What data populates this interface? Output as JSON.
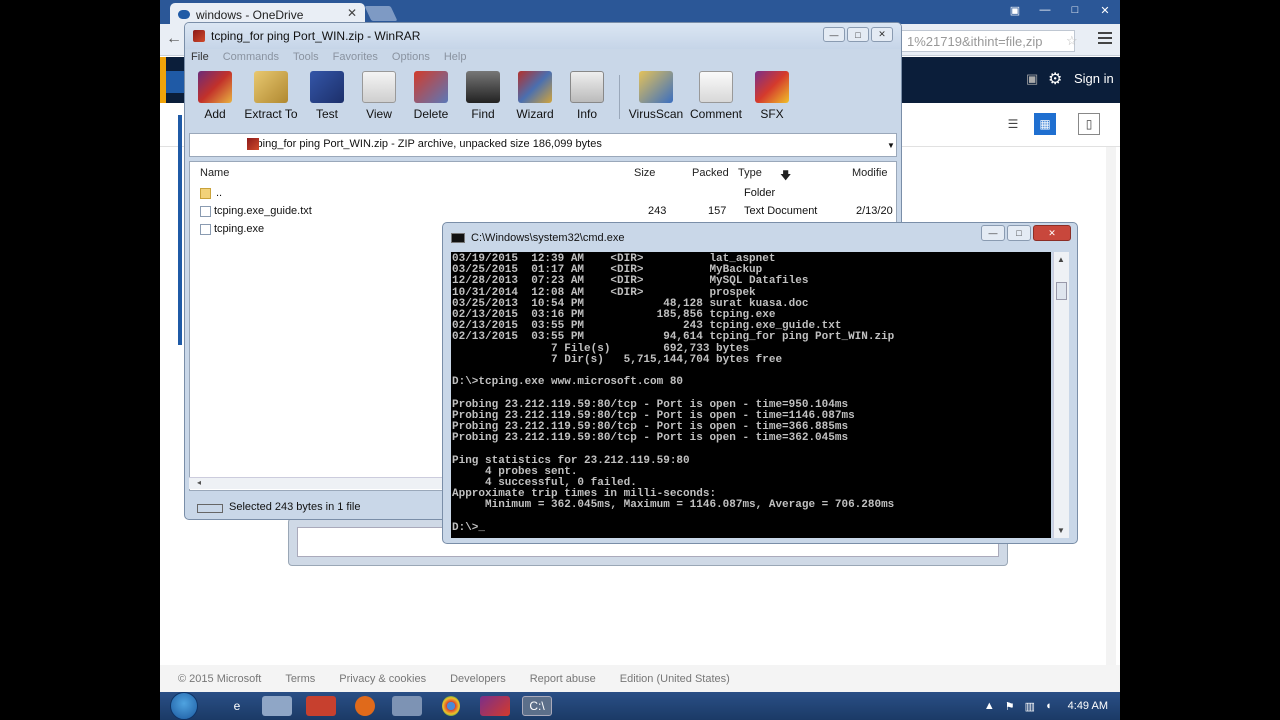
{
  "chrome": {
    "tab_title": "windows - OneDrive",
    "url_tail": "1%21719&ithint=file,zip",
    "tab_close": "✕"
  },
  "onedrive": {
    "sign_in": "Sign in",
    "footer": {
      "copyright": "© 2015 Microsoft",
      "terms": "Terms",
      "privacy": "Privacy & cookies",
      "developers": "Developers",
      "report": "Report abuse",
      "edition": "Edition (United States)"
    }
  },
  "winrar": {
    "title": "tcping_for ping Port_WIN.zip - WinRAR",
    "menu": [
      "File",
      "Commands",
      "Tools",
      "Favorites",
      "Options",
      "Help"
    ],
    "toolbar": [
      "Add",
      "Extract To",
      "Test",
      "View",
      "Delete",
      "Find",
      "Wizard",
      "Info",
      "VirusScan",
      "Comment",
      "SFX"
    ],
    "address": "tcping_for ping Port_WIN.zip - ZIP archive, unpacked size 186,099 bytes",
    "columns": {
      "name": "Name",
      "size": "Size",
      "packed": "Packed",
      "type": "Type",
      "modified": "Modifie"
    },
    "rows": [
      {
        "name": "..",
        "size": "",
        "packed": "",
        "type": "Folder",
        "modified": ""
      },
      {
        "name": "tcping.exe_guide.txt",
        "size": "243",
        "packed": "157",
        "type": "Text Document",
        "modified": "2/13/20"
      },
      {
        "name": "tcping.exe",
        "size": "",
        "packed": "",
        "type": "",
        "modified": ""
      }
    ],
    "status": "Selected 243 bytes in 1 file"
  },
  "cmd": {
    "title": "C:\\Windows\\system32\\cmd.exe",
    "text": "03/19/2015  12:39 AM    <DIR>          lat_aspnet\n03/25/2015  01:17 AM    <DIR>          MyBackup\n12/28/2013  07:23 AM    <DIR>          MySQL Datafiles\n10/31/2014  12:08 AM    <DIR>          prospek\n03/25/2013  10:54 PM            48,128 surat kuasa.doc\n02/13/2015  03:16 PM           185,856 tcping.exe\n02/13/2015  03:55 PM               243 tcping.exe_guide.txt\n02/13/2015  03:55 PM            94,614 tcping_for ping Port_WIN.zip\n               7 File(s)        692,733 bytes\n               7 Dir(s)   5,715,144,704 bytes free\n\nD:\\>tcping.exe www.microsoft.com 80\n\nProbing 23.212.119.59:80/tcp - Port is open - time=950.104ms\nProbing 23.212.119.59:80/tcp - Port is open - time=1146.087ms\nProbing 23.212.119.59:80/tcp - Port is open - time=366.885ms\nProbing 23.212.119.59:80/tcp - Port is open - time=362.045ms\n\nPing statistics for 23.212.119.59:80\n     4 probes sent.\n     4 successful, 0 failed.\nApproximate trip times in milli-seconds:\n     Minimum = 362.045ms, Maximum = 1146.087ms, Average = 706.280ms\n\nD:\\>_"
  },
  "taskbar": {
    "clock": "4:49 AM"
  }
}
